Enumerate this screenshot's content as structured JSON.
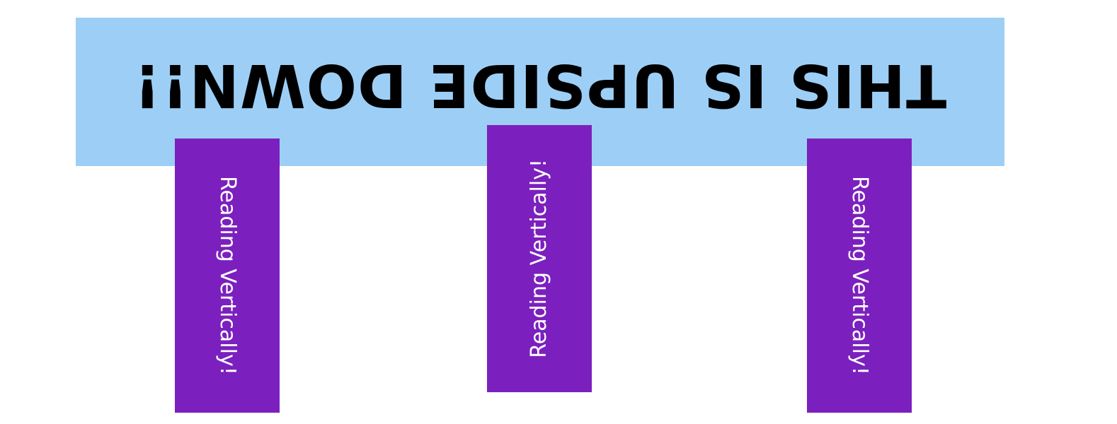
{
  "colors": {
    "banner_background": "#9dcff6",
    "banner_text": "#000000",
    "box_background": "#7b20be",
    "box_text": "#ffffff"
  },
  "banner": {
    "text": "THIS IS UPSIDE DOWN!!"
  },
  "boxes": [
    {
      "text": "Reading Vertically!",
      "direction": "top-to-bottom"
    },
    {
      "text": "Reading Vertically!",
      "direction": "bottom-to-top"
    },
    {
      "text": "Reading Vertically!",
      "direction": "top-to-bottom"
    }
  ]
}
